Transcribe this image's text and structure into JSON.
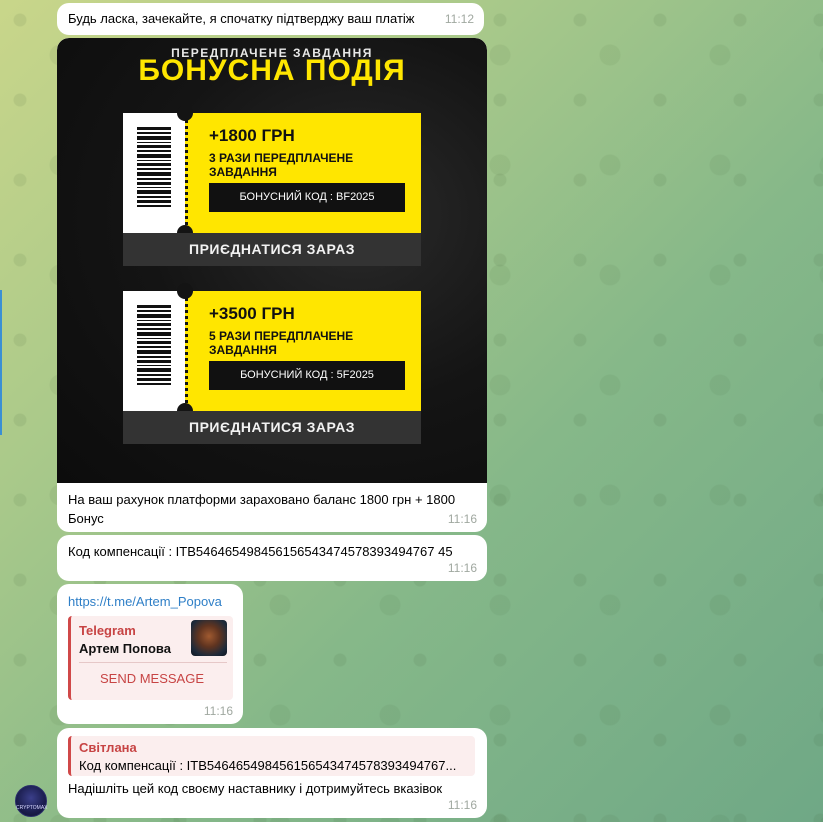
{
  "messages": {
    "m1": {
      "text": "Будь ласка, зачекайте, я спочатку підтверджу ваш платіж",
      "time": "11:12"
    },
    "m2": {
      "image": {
        "subtitle": "ПЕРЕДПЛАЧЕНЕ ЗАВДАННЯ",
        "title": "БОНУСНА ПОДІЯ",
        "tickets": [
          {
            "amount": "+1800 ГРН",
            "desc": "3 РАЗИ ПЕРЕДПЛАЧЕНЕ ЗАВДАННЯ",
            "code": "БОНУСНИЙ КОД : BF2025",
            "button": "ПРИЄДНАТИСЯ ЗАРАЗ"
          },
          {
            "amount": "+3500 ГРН",
            "desc": "5 РАЗИ ПЕРЕДПЛАЧЕНЕ ЗАВДАННЯ",
            "code": "БОНУСНИЙ КОД : 5F2025",
            "button": "ПРИЄДНАТИСЯ ЗАРАЗ"
          }
        ]
      },
      "caption": "На ваш рахунок платформи зараховано баланс 1800 грн + 1800 Бонус",
      "time": "11:16"
    },
    "m3": {
      "text": "Код компенсації : ITB546465498456156543474578393494767 45",
      "time": "11:16"
    },
    "m4": {
      "link": "https://t.me/Artem_Popova",
      "preview": {
        "site": "Telegram",
        "name": "Артем Попова",
        "button": "SEND MESSAGE"
      },
      "time": "11:16"
    },
    "m5": {
      "reply_name": "Світлана",
      "reply_text": "Код компенсації : ITB546465498456156543474578393494767...",
      "text": "Надішліть цей код своєму наставнику і дотримуйтесь вказівок",
      "time": "11:16"
    }
  },
  "avatar_label": "CRYPTOMAX"
}
